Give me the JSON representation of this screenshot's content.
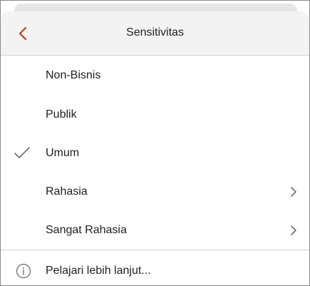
{
  "header": {
    "title": "Sensitivitas",
    "back_icon": "chevron-left-icon",
    "back_color": "#c43e1c"
  },
  "items": [
    {
      "label": "Non-Bisnis",
      "checked": false,
      "has_submenu": false
    },
    {
      "label": "Publik",
      "checked": false,
      "has_submenu": false
    },
    {
      "label": "Umum",
      "checked": true,
      "has_submenu": false
    },
    {
      "label": "Rahasia",
      "checked": false,
      "has_submenu": true
    },
    {
      "label": "Sangat Rahasia",
      "checked": false,
      "has_submenu": true
    }
  ],
  "footer": {
    "learn_more_label": "Pelajari lebih lanjut...",
    "icon": "info-icon"
  },
  "colors": {
    "accent": "#c43e1c",
    "text": "#1f1f1f",
    "icon_gray": "#6e6e6e",
    "header_bg": "#f3f3f3",
    "divider": "#d2d2d2"
  }
}
